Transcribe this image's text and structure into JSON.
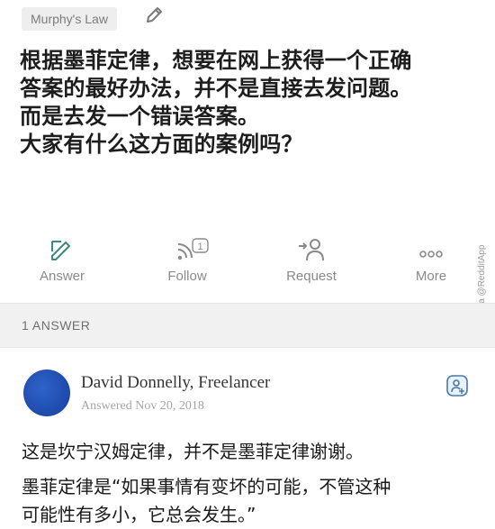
{
  "topic": {
    "label": "Murphy's Law"
  },
  "question": {
    "lines": [
      "根据墨菲定律，想要在网上获得一个正确",
      "答案的最好办法，并不是直接去发问题。",
      "而是去发一个错误答案。",
      "大家有什么这方面的案例吗？"
    ]
  },
  "actions": {
    "answer": "Answer",
    "follow": "Follow",
    "follow_count": "1",
    "request": "Request",
    "more": "More"
  },
  "watermark": "via @RedditApp",
  "answers_header": "1 ANSWER",
  "answer": {
    "author": "David Donnelly, Freelancer",
    "date": "Answered Nov 20, 2018",
    "paragraph1": "这是坎宁汉姆定律，并不是墨菲定律谢谢。",
    "paragraph2_lines": [
      "墨菲定律是“如果事情有变坏的可能，不管这种",
      "可能性有多小，它总会发生。”"
    ]
  },
  "icons": {
    "edit": "pencil-icon",
    "answer": "answer-pencil-icon",
    "follow": "follow-rss-icon",
    "request": "request-user-icon",
    "more": "more-dots-icon",
    "follow_author": "follow-author-icon"
  },
  "colors": {
    "accent": "#2f63c9",
    "icon_green": "#3a8a80",
    "muted": "#8a8a8a"
  }
}
